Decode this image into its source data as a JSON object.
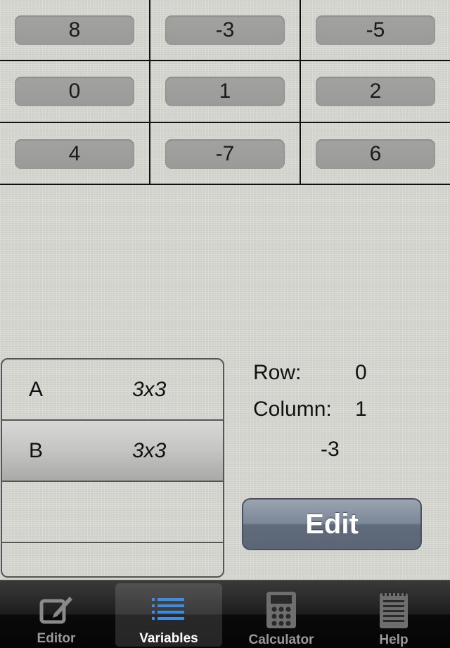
{
  "matrix": {
    "rows": [
      [
        "8",
        "-3",
        "-5"
      ],
      [
        "0",
        "1",
        "2"
      ],
      [
        "4",
        "-7",
        "6"
      ]
    ]
  },
  "variables": [
    {
      "name": "A",
      "size": "3x3",
      "selected": false
    },
    {
      "name": "B",
      "size": "3x3",
      "selected": true
    },
    {
      "name": "",
      "size": "",
      "selected": false
    }
  ],
  "info": {
    "row_label": "Row:",
    "row_value": "0",
    "column_label": "Column:",
    "column_value": "1",
    "cell_value": "-3"
  },
  "edit_button": {
    "label": "Edit"
  },
  "tabbar": {
    "tabs": [
      {
        "label": "Editor",
        "icon": "pencil-square-icon",
        "active": false
      },
      {
        "label": "Variables",
        "icon": "list-icon",
        "active": true
      },
      {
        "label": "Calculator",
        "icon": "calculator-icon",
        "active": false
      },
      {
        "label": "Help",
        "icon": "notepad-icon",
        "active": false
      }
    ]
  }
}
